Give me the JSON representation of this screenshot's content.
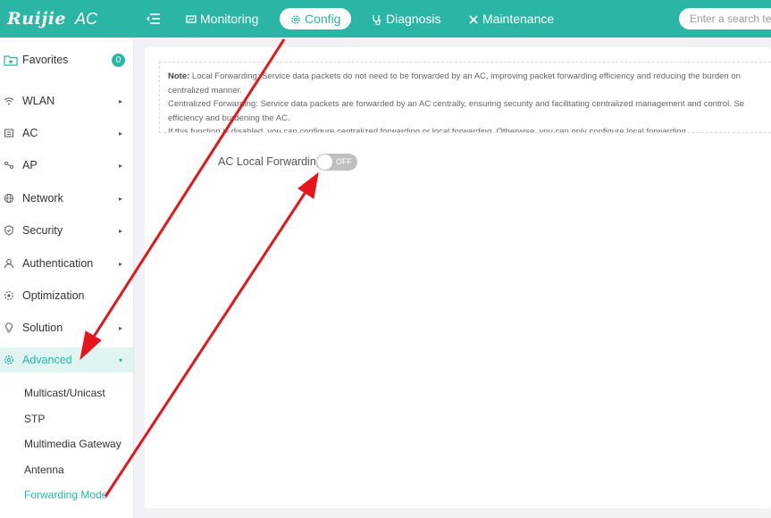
{
  "header": {
    "logo": "Ruijie",
    "product": "AC",
    "nav": [
      {
        "label": "Monitoring",
        "icon": "monitor-icon"
      },
      {
        "label": "Config",
        "icon": "gear-icon",
        "active": true
      },
      {
        "label": "Diagnosis",
        "icon": "stethoscope-icon"
      },
      {
        "label": "Maintenance",
        "icon": "tools-icon"
      }
    ],
    "search_placeholder": "Enter a search term"
  },
  "sidebar": {
    "favorites": {
      "label": "Favorites",
      "count": "0"
    },
    "items": [
      {
        "label": "WLAN",
        "icon": "wifi-icon"
      },
      {
        "label": "AC",
        "icon": "ac-icon"
      },
      {
        "label": "AP",
        "icon": "ap-icon"
      },
      {
        "label": "Network",
        "icon": "globe-icon"
      },
      {
        "label": "Security",
        "icon": "shield-icon"
      },
      {
        "label": "Authentication",
        "icon": "user-icon"
      },
      {
        "label": "Optimization",
        "icon": "optimize-icon"
      },
      {
        "label": "Solution",
        "icon": "bulb-icon"
      },
      {
        "label": "Advanced",
        "icon": "gear-icon",
        "active": true
      }
    ],
    "subitems": [
      {
        "label": "Multicast/Unicast"
      },
      {
        "label": "STP"
      },
      {
        "label": "Multimedia Gateway"
      },
      {
        "label": "Antenna"
      },
      {
        "label": "Forwarding Mode",
        "active": true
      }
    ]
  },
  "content": {
    "note": {
      "prefix": "Note:",
      "line1": " Local Forwarding: Service data packets do not need to be forwarded by an AC, improving packet forwarding efficiency and reducing the burden on",
      "line2": "centralized manner.",
      "line3": "Centralized Forwarding: Service data packets are forwarded by an AC centrally, ensuring security and facilitating centralized management and control. Se",
      "line4": "efficiency and burdening the AC.",
      "line5": "If this function is disabled, you can configure centralized forwarding or local forwarding. Otherwise, you can only configure local forwarding."
    },
    "toggle": {
      "label": "AC Local Forwarding",
      "state": "OFF"
    }
  },
  "colors": {
    "accent": "#2bb5a4",
    "annotation": "#e8141b"
  }
}
